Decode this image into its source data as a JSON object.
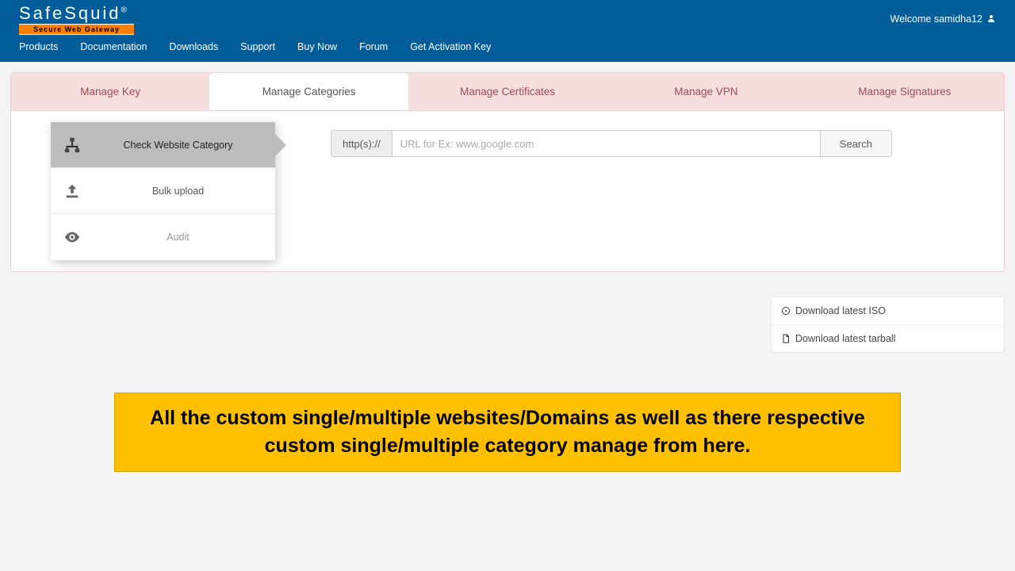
{
  "header": {
    "logo_text": "SafeSquid",
    "logo_reg": "®",
    "logo_tagline": "Secure Web Gateway",
    "welcome": "Welcome samidha12",
    "nav": [
      "Products",
      "Documentation",
      "Downloads",
      "Support",
      "Buy Now",
      "Forum",
      "Get Activation Key"
    ]
  },
  "tabs": [
    {
      "label": "Manage Key",
      "active": false
    },
    {
      "label": "Manage Categories",
      "active": true
    },
    {
      "label": "Manage Certificates",
      "active": false
    },
    {
      "label": "Manage VPN",
      "active": false
    },
    {
      "label": "Manage Signatures",
      "active": false
    }
  ],
  "sidelist": [
    {
      "label": "Check Website Category",
      "icon": "sitemap",
      "active": true
    },
    {
      "label": "Bulk upload",
      "icon": "upload",
      "active": false
    },
    {
      "label": "Audit",
      "icon": "eye",
      "active": false
    }
  ],
  "search": {
    "scheme": "http(s)://",
    "placeholder": "URL for Ex: www.google.com",
    "button": "Search"
  },
  "downloads": [
    {
      "icon": "disc",
      "label": "Download latest ISO"
    },
    {
      "icon": "file",
      "label": "Download latest tarball"
    }
  ],
  "callout": "All the custom single/multiple websites/Domains as well as there respective custom single/multiple category manage from here."
}
